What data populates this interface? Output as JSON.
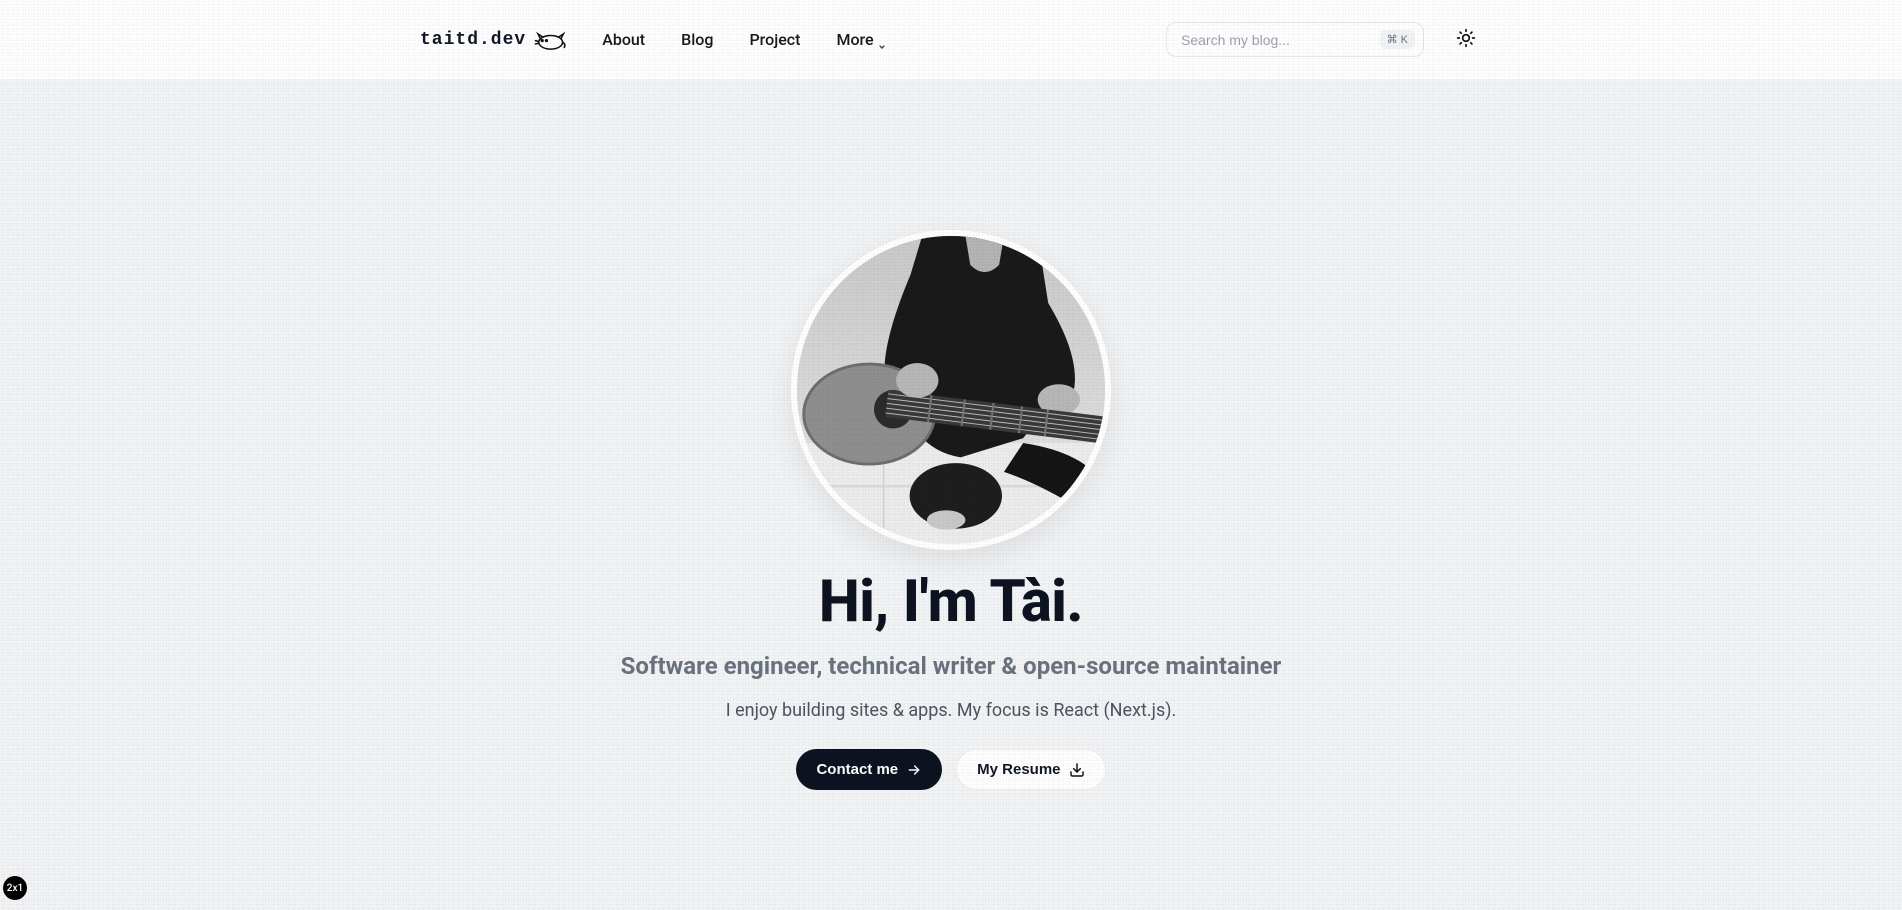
{
  "header": {
    "logo_text": "taitd.dev",
    "nav": {
      "about": "About",
      "blog": "Blog",
      "project": "Project",
      "more": "More"
    },
    "search": {
      "placeholder": "Search my blog...",
      "shortcut": "⌘ K"
    }
  },
  "hero": {
    "title": "Hi, I'm Tài.",
    "subtitle": "Software engineer, technical writer & open-source maintainer",
    "description": "I enjoy building sites & apps. My focus is React (Next.js).",
    "contact_button": "Contact me",
    "resume_button": "My Resume"
  },
  "badge": "2x1"
}
